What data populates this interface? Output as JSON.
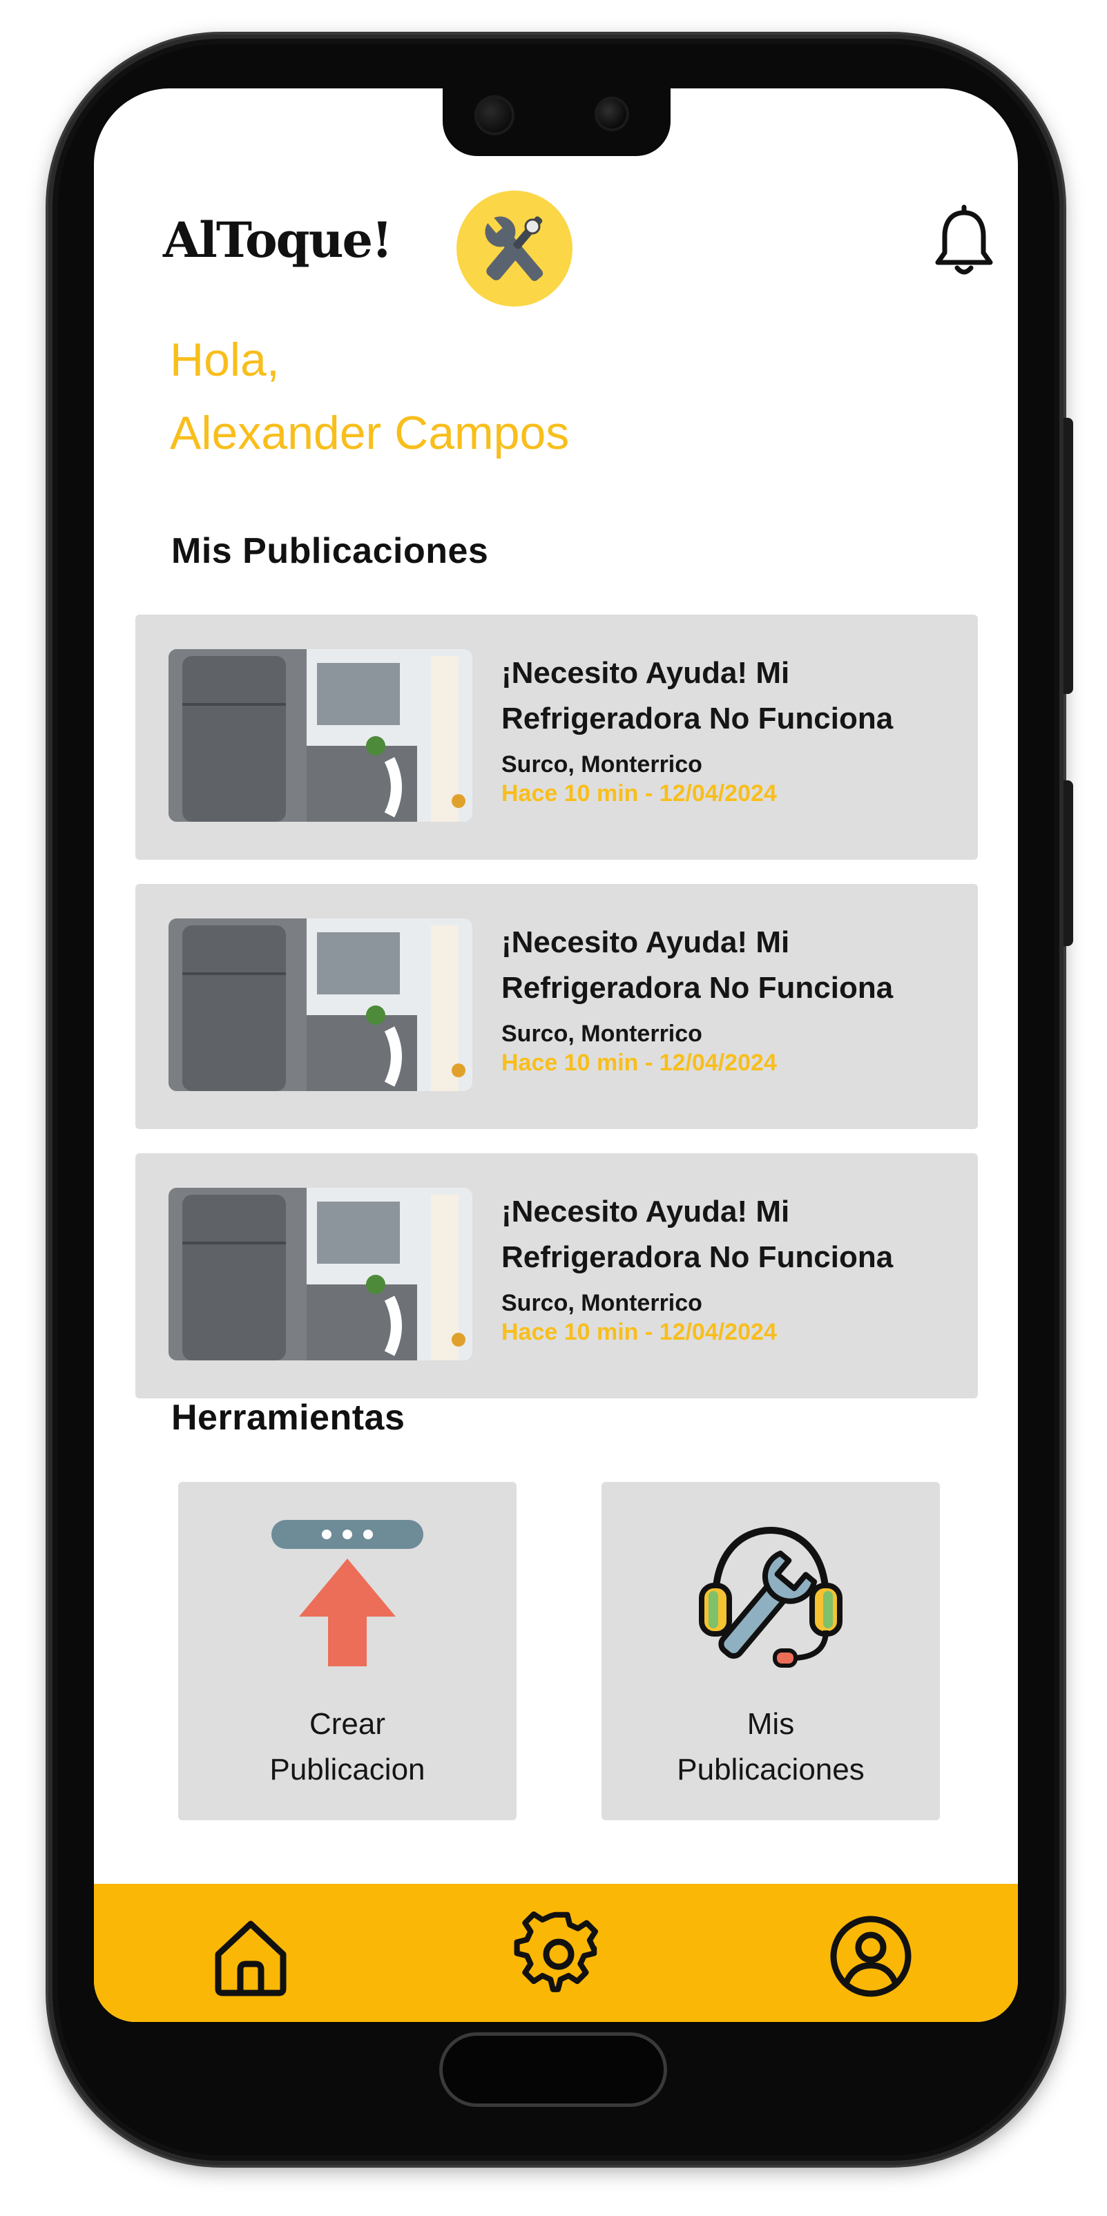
{
  "app": {
    "logo_text": "AlToque!"
  },
  "greeting": {
    "line1": "Hola,",
    "line2": "Alexander Campos"
  },
  "publications": {
    "section_title": "Mis Publicaciones",
    "items": [
      {
        "title": "¡Necesito Ayuda! Mi Refrigeradora No Funciona",
        "location": "Surco, Monterrico",
        "time": "Hace 10 min - 12/04/2024"
      },
      {
        "title": "¡Necesito Ayuda! Mi Refrigeradora No Funciona",
        "location": "Surco, Monterrico",
        "time": "Hace 10 min - 12/04/2024"
      },
      {
        "title": "¡Necesito Ayuda! Mi Refrigeradora No Funciona",
        "location": "Surco, Monterrico",
        "time": "Hace 10 min - 12/04/2024"
      }
    ]
  },
  "tools": {
    "section_title": "Herramientas",
    "items": [
      {
        "label": "Crear\nPublicacion",
        "icon": "upload-arrow-icon"
      },
      {
        "label": "Mis\nPublicaciones",
        "icon": "wrench-headset-icon"
      }
    ]
  },
  "nav": {
    "items": [
      {
        "icon": "home-icon"
      },
      {
        "icon": "gear-icon"
      },
      {
        "icon": "user-circle-icon"
      }
    ]
  },
  "colors": {
    "accent": "#f8be1c",
    "nav_bg": "#fbb705",
    "card_bg": "#dedede",
    "upload_arrow": "#ec6e58"
  }
}
